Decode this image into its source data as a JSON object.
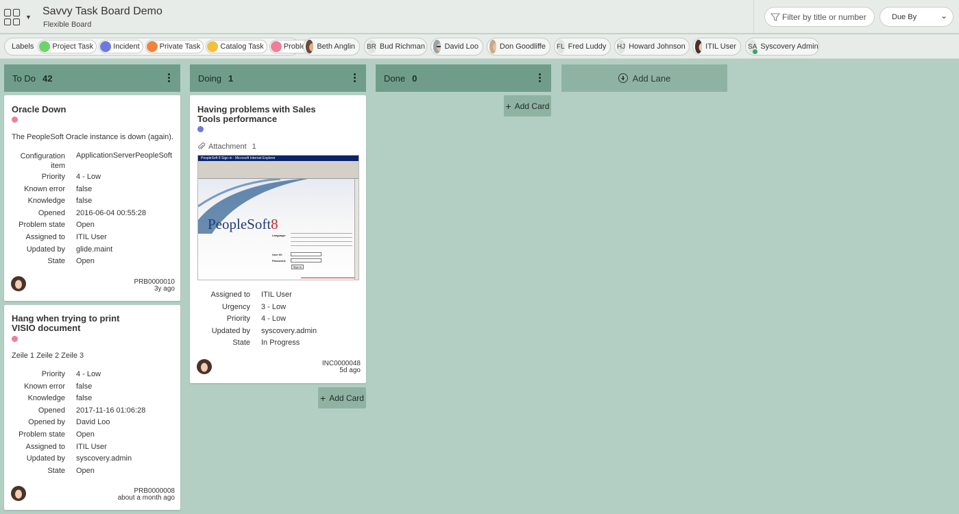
{
  "header": {
    "title": "Savvy Task Board Demo",
    "subtitle": "Flexible Board",
    "filter_placeholder": "Filter by title or number",
    "sort_label": "Due By"
  },
  "labels": {
    "title": "Labels",
    "items": [
      {
        "label": "Project Task",
        "color": "#6fd36a"
      },
      {
        "label": "Incident",
        "color": "#6c7ae0"
      },
      {
        "label": "Private Task",
        "color": "#f0843c"
      },
      {
        "label": "Catalog Task",
        "color": "#f5c03a"
      },
      {
        "label": "Problem",
        "color": "#f07e9a"
      }
    ]
  },
  "people": [
    {
      "name": "Beth Anglin",
      "initials": ""
    },
    {
      "name": "Bud Richman",
      "initials": "BR"
    },
    {
      "name": "David Loo",
      "initials": ""
    },
    {
      "name": "Don Goodliffe",
      "initials": ""
    },
    {
      "name": "Fred Luddy",
      "initials": "FL"
    },
    {
      "name": "Howard Johnson",
      "initials": "HJ"
    },
    {
      "name": "ITIL User",
      "initials": ""
    },
    {
      "name": "Syscovery Admin",
      "initials": "SA"
    }
  ],
  "lanes": [
    {
      "name": "To Do",
      "count": "42"
    },
    {
      "name": "Doing",
      "count": "1"
    },
    {
      "name": "Done",
      "count": "0"
    }
  ],
  "add_lane": "Add Lane",
  "add_card": "Add Card",
  "cards": {
    "c1": {
      "title": "Oracle Down",
      "description": "The PeopleSoft Oracle instance is down (again).",
      "fields": [
        {
          "k": "Configuration item",
          "v": "ApplicationServerPeopleSoft"
        },
        {
          "k": "Priority",
          "v": "4 - Low"
        },
        {
          "k": "Known error",
          "v": "false"
        },
        {
          "k": "Knowledge",
          "v": "false"
        },
        {
          "k": "Opened",
          "v": "2016-06-04 00:55:28"
        },
        {
          "k": "Problem state",
          "v": "Open"
        },
        {
          "k": "Assigned to",
          "v": "ITIL User"
        },
        {
          "k": "Updated by",
          "v": "glide.maint"
        },
        {
          "k": "State",
          "v": "Open"
        }
      ],
      "number": "PRB0000010",
      "age": "3y ago"
    },
    "c2": {
      "title_line1": "Hang when trying to print",
      "title_line2": "VISIO document",
      "description": "Zeile 1 Zeile 2 Zeile 3",
      "fields": [
        {
          "k": "Priority",
          "v": "4 - Low"
        },
        {
          "k": "Known error",
          "v": "false"
        },
        {
          "k": "Knowledge",
          "v": "false"
        },
        {
          "k": "Opened",
          "v": "2017-11-16 01:06:28"
        },
        {
          "k": "Opened by",
          "v": "David Loo"
        },
        {
          "k": "Problem state",
          "v": "Open"
        },
        {
          "k": "Assigned to",
          "v": "ITIL User"
        },
        {
          "k": "Updated by",
          "v": "syscovery.admin"
        },
        {
          "k": "State",
          "v": "Open"
        }
      ],
      "number": "PRB0000008",
      "age": "about a month ago"
    },
    "c3": {
      "title_line1": "Having problems with Sales",
      "title_line2": "Tools performance",
      "attachment_label": "Attachment",
      "attachment_count": "1",
      "thumb_title": "PeopleSoft 8 Sign-in - Microsoft Internet Explorer",
      "thumb_brand": "PeopleSoft",
      "thumb_version": "8",
      "thumb_language": "Language:",
      "thumb_userid": "User ID:",
      "thumb_password": "Password:",
      "thumb_signin": "Sign In",
      "fields": [
        {
          "k": "Assigned to",
          "v": "ITIL User"
        },
        {
          "k": "Urgency",
          "v": "3 - Low"
        },
        {
          "k": "Priority",
          "v": "4 - Low"
        },
        {
          "k": "Updated by",
          "v": "syscovery.admin"
        },
        {
          "k": "State",
          "v": "In Progress"
        }
      ],
      "number": "INC0000048",
      "age": "5d ago"
    }
  }
}
